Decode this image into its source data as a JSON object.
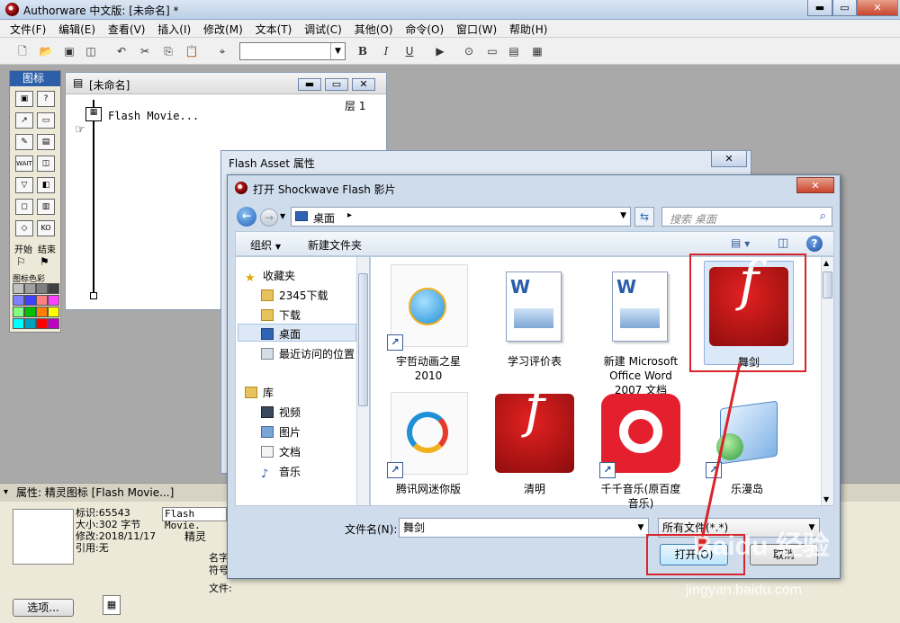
{
  "app": {
    "title": "Authorware 中文版: [未命名] *",
    "menu": [
      "文件(F)",
      "编辑(E)",
      "查看(V)",
      "插入(I)",
      "修改(M)",
      "文本(T)",
      "调试(C)",
      "其他(O)",
      "命令(O)",
      "窗口(W)",
      "帮助(H)"
    ],
    "window_buttons": [
      "▬",
      "▭",
      "✕"
    ],
    "toolbar": {
      "bold_label": "B",
      "italic_label": "I",
      "underline_label": "U",
      "font_combo_value": ""
    }
  },
  "palette": {
    "title": "图标",
    "start_label": "开始",
    "end_label": "结束",
    "colors_label": "图标色彩",
    "swatches": [
      "#c0c0c0",
      "#a0a0a0",
      "#808080",
      "#404040",
      "#8080ff",
      "#4040ff",
      "#ff8080",
      "#ff40ff",
      "#80ff80",
      "#00c000",
      "#ff8000",
      "#ffff00",
      "#00ffff",
      "#00a0c0",
      "#ff0000",
      "#c000c0"
    ]
  },
  "flow_window": {
    "title": "[未命名]",
    "layer_label": "层 1",
    "icon_label": "Flash Movie..."
  },
  "properties": {
    "title": "属性: 精灵图标 [Flash Movie...]",
    "id_line": "标识:65543",
    "size_line": "大小:302 字节",
    "modified_line": "修改:2018/11/17",
    "ref_line": "引用:无",
    "name_value": "Flash Movie.",
    "options_button": "选项...",
    "tab_label": "精灵",
    "field_name": "名字",
    "field_symbol": "符号",
    "field_file": "文件:"
  },
  "asset_dialog": {
    "title": "Flash Asset 属性",
    "close": "✕"
  },
  "open_dialog": {
    "title": "打开 Shockwave Flash 影片",
    "close": "✕",
    "address": "桌面",
    "address_arrow": "▸",
    "search_placeholder": "搜索 桌面",
    "organize_label": "组织",
    "new_folder_label": "新建文件夹",
    "nav": {
      "favorites": "收藏夹",
      "items": [
        "2345下载",
        "下载",
        "桌面",
        "最近访问的位置"
      ],
      "library": "库",
      "library_items": [
        "视频",
        "图片",
        "文档",
        "音乐"
      ]
    },
    "files": [
      {
        "name": "宇哲动画之星 2010",
        "kind": "shortcut"
      },
      {
        "name": "学习评价表",
        "kind": "word"
      },
      {
        "name": "新建 Microsoft Office Word 2007 文档",
        "kind": "word"
      },
      {
        "name": "舞剑",
        "kind": "flash",
        "selected": true
      },
      {
        "name": "腾讯网迷你版",
        "kind": "shortcut"
      },
      {
        "name": "清明",
        "kind": "flash"
      },
      {
        "name": "千千音乐(原百度音乐)",
        "kind": "shortcut"
      },
      {
        "name": "乐漫岛",
        "kind": "shortcut"
      }
    ],
    "filename_label": "文件名(N):",
    "filename_value": "舞剑",
    "filetype_value": "所有文件(*.*)",
    "open_button": "打开(O)",
    "cancel_button": "取消"
  },
  "watermark": {
    "brand": "Baidu 经验",
    "url": "jingyan.baidu.com"
  }
}
